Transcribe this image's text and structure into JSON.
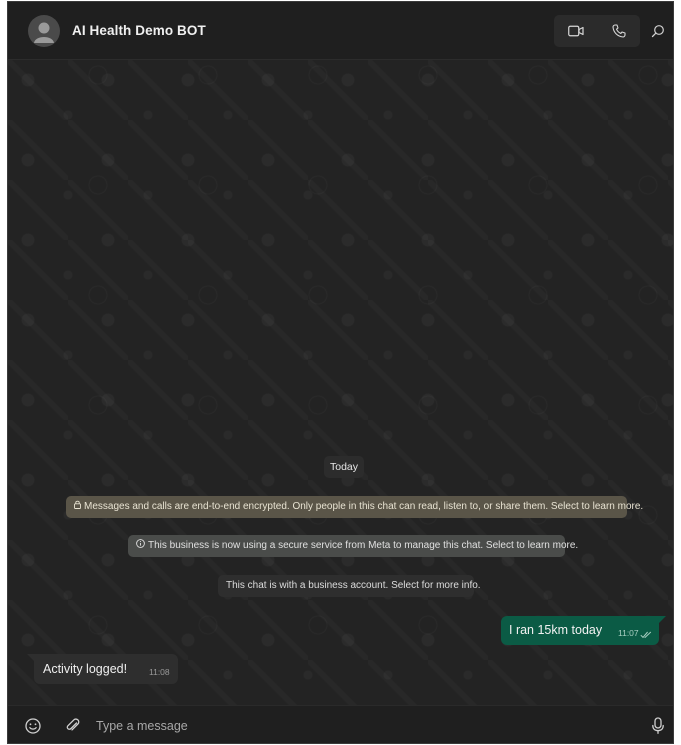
{
  "header": {
    "title": "AI Health Demo BOT",
    "avatar_icon": "person-icon",
    "video_call_icon": "video-camera-icon",
    "voice_call_icon": "phone-icon",
    "search_icon": "search-icon"
  },
  "chat": {
    "date_separator": "Today",
    "system_messages": {
      "encrypted": "Messages and calls are end-to-end encrypted. Only people in this chat can read, listen to, or share them. Select to learn more.",
      "meta_service": "This business is now using a secure service from Meta to manage this chat. Select to learn more.",
      "business_account": "This chat is with a business account. Select for more info."
    },
    "messages": [
      {
        "direction": "outgoing",
        "text": "I ran 15km today",
        "time": "11:07",
        "status": "read"
      },
      {
        "direction": "incoming",
        "text": "Activity logged!",
        "time": "11:08"
      }
    ]
  },
  "composer": {
    "placeholder": "Type a message",
    "emoji_icon": "emoji-icon",
    "attach_icon": "paperclip-icon",
    "mic_icon": "microphone-icon"
  },
  "colors": {
    "outgoing_bubble": "#0b5b45",
    "incoming_bubble": "#2e2e2e",
    "encryption_banner": "#5a5548",
    "background": "#232323"
  }
}
